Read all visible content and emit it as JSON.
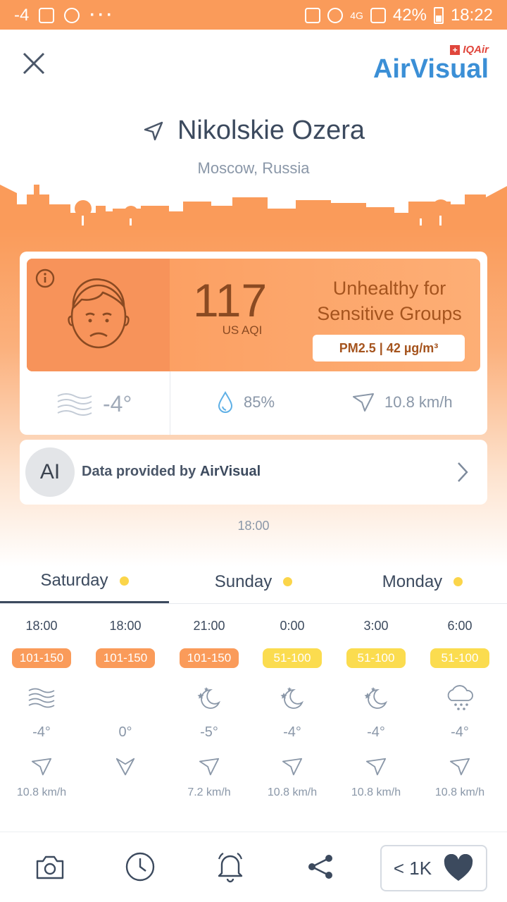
{
  "status_bar": {
    "left_label": "-4",
    "dots": "···",
    "network": "4G",
    "battery": "42%",
    "time": "18:22"
  },
  "brand": {
    "top": "IQAir",
    "main": "AirVisual"
  },
  "location": {
    "city": "Nikolskie Ozera",
    "country": "Moscow, Russia"
  },
  "aqi": {
    "value": "117",
    "unit": "US AQI",
    "status": "Unhealthy for Sensitive Groups",
    "pollutant": "PM2.5 | 42 µg/m³",
    "color": "#fa9b5a"
  },
  "weather": {
    "temperature": "-4°",
    "humidity": "85%",
    "wind": "10.8 km/h"
  },
  "provider": {
    "avatar": "AI",
    "prefix": "Data provided by ",
    "name": "AirVisual"
  },
  "timestamp": "18:00",
  "tabs": [
    {
      "label": "Saturday"
    },
    {
      "label": "Sunday"
    },
    {
      "label": "Monday"
    }
  ],
  "forecast": [
    {
      "time": "18:00",
      "range": "101-150",
      "level": "orange",
      "icon": "haze-icon",
      "temp": "-4°",
      "wind_dir": "northeast",
      "speed": "10.8 km/h"
    },
    {
      "time": "18:00",
      "range": "101-150",
      "level": "orange",
      "icon": "none",
      "temp": "0°",
      "wind_dir": "south",
      "speed": ""
    },
    {
      "time": "21:00",
      "range": "101-150",
      "level": "orange",
      "icon": "night-clear-icon",
      "temp": "-5°",
      "wind_dir": "northeast",
      "speed": "7.2 km/h"
    },
    {
      "time": "0:00",
      "range": "51-100",
      "level": "yellow",
      "icon": "night-clear-icon",
      "temp": "-4°",
      "wind_dir": "northeast",
      "speed": "10.8 km/h"
    },
    {
      "time": "3:00",
      "range": "51-100",
      "level": "yellow",
      "icon": "night-clear-icon",
      "temp": "-4°",
      "wind_dir": "northeast",
      "speed": "10.8 km/h"
    },
    {
      "time": "6:00",
      "range": "51-100",
      "level": "yellow",
      "icon": "snow-icon",
      "temp": "-4°",
      "wind_dir": "northeast",
      "speed": "10.8 km/h"
    }
  ],
  "bottom_nav": {
    "favorite_count": "< 1K"
  },
  "colors": {
    "orange": "#fa9b5a",
    "yellow": "#fbdc4f",
    "text_dark": "#3c4a5e",
    "brand_blue": "#3b8fd6"
  }
}
